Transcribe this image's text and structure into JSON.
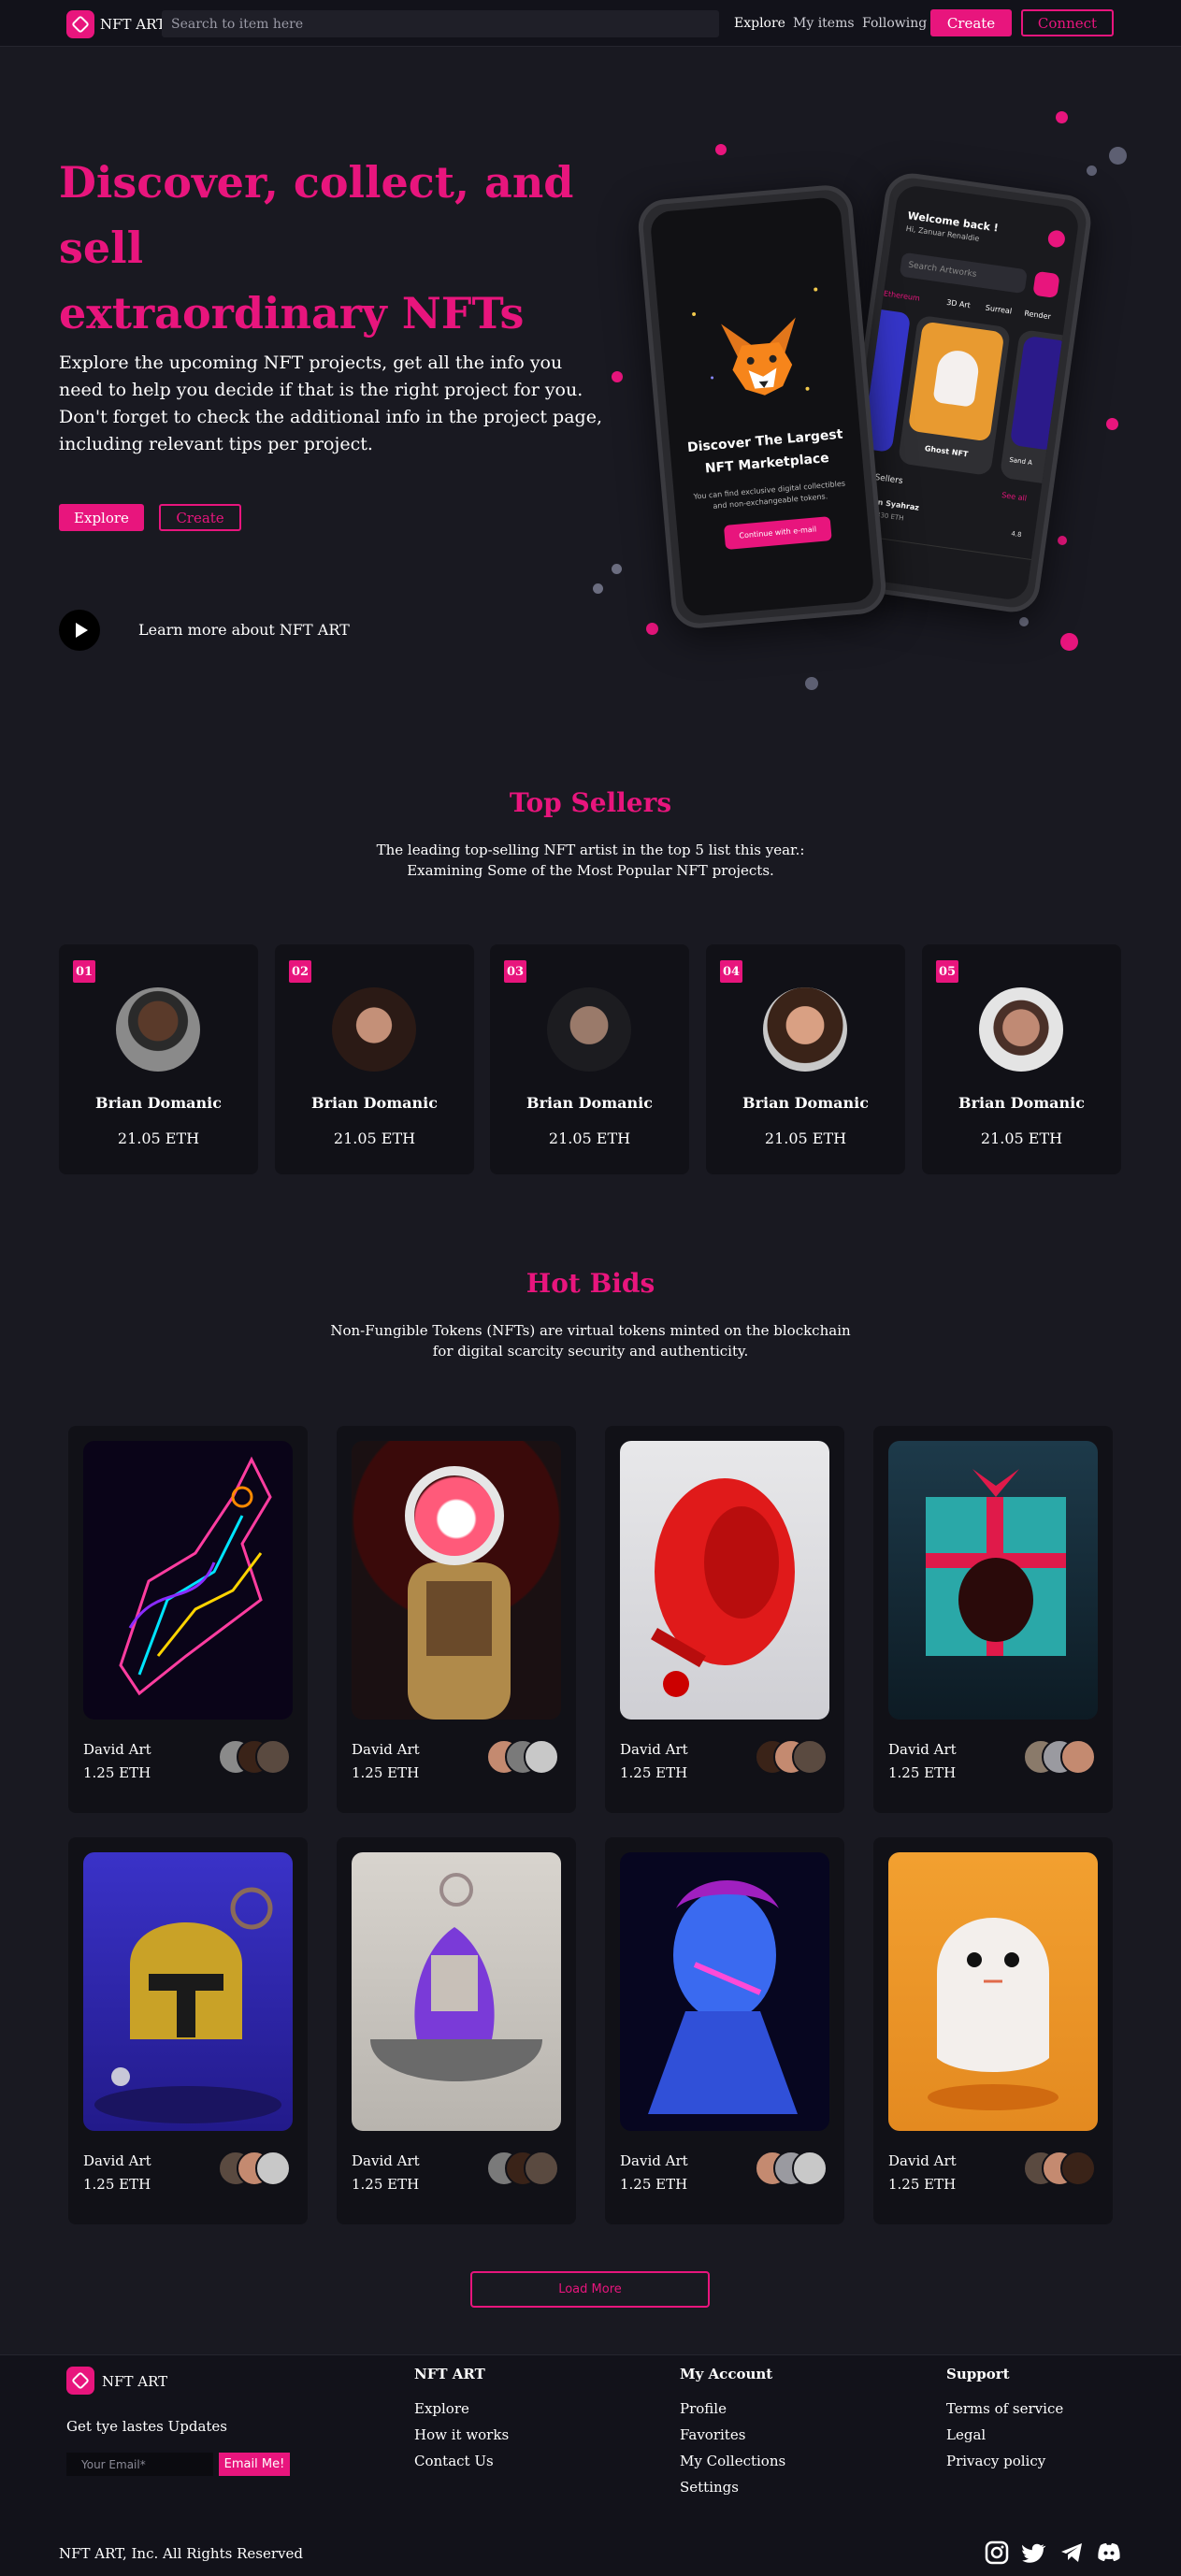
{
  "nav": {
    "logo": "NFT ART",
    "search_placeholder": "Search to item here",
    "links": [
      "Explore",
      "My items",
      "Following"
    ],
    "create_label": "Create",
    "connect_label": "Connect"
  },
  "hero": {
    "title_line1": "Discover, collect, and sell",
    "title_line2": "extraordinary NFTs",
    "description": "Explore the upcoming NFT projects, get all the info you need to help you decide if that is the right project for you. Don't forget to check the additional info in the project page, including relevant tips per project.",
    "explore_label": "Explore",
    "create_label": "Create",
    "learn_more": "Learn more about NFT ART",
    "phone_left": {
      "heading1": "Discover The Largest",
      "heading2": "NFT Marketplace",
      "body1": "You can find exclusive digital collectibles",
      "body2": "and non-exchangeable tokens.",
      "button": "Continue with e-mail"
    },
    "phone_right": {
      "welcome": "Welcome back !",
      "user": "Hi, Zanuar Renaldie",
      "search": "Search Artworks",
      "tabs": [
        "Ethereum",
        "3D Art",
        "Surreal",
        "Render"
      ],
      "card_title": "Ghost NFT",
      "card_side": "Sand A",
      "sellers": "Top Sellers",
      "see_all": "See all",
      "seller_name": "Elin Syahraz",
      "seller_value": "98.830 ETH",
      "seller_score": "4.8"
    }
  },
  "top_sellers": {
    "title": "Top Sellers",
    "sub_line1": "The leading top-selling NFT artist in the top 5 list this year.:",
    "sub_line2": "Examining Some of the Most Popular NFT projects.",
    "sellers": [
      {
        "rank": "01",
        "name": "Brian Domanic",
        "eth": "21.05 ETH"
      },
      {
        "rank": "02",
        "name": "Brian Domanic",
        "eth": "21.05 ETH"
      },
      {
        "rank": "03",
        "name": "Brian Domanic",
        "eth": "21.05 ETH"
      },
      {
        "rank": "04",
        "name": "Brian Domanic",
        "eth": "21.05 ETH"
      },
      {
        "rank": "05",
        "name": "Brian Domanic",
        "eth": "21.05 ETH"
      }
    ]
  },
  "hot_bids": {
    "title": "Hot Bids",
    "sub_line1": "Non-Fungible Tokens (NFTs) are virtual tokens minted on the blockchain",
    "sub_line2": "for digital scarcity security and authenticity.",
    "items": [
      {
        "owner": "David Art",
        "price": "1.25 ETH"
      },
      {
        "owner": "David Art",
        "price": "1.25 ETH"
      },
      {
        "owner": "David Art",
        "price": "1.25 ETH"
      },
      {
        "owner": "David Art",
        "price": "1.25 ETH"
      },
      {
        "owner": "David Art",
        "price": "1.25 ETH"
      },
      {
        "owner": "David Art",
        "price": "1.25 ETH"
      },
      {
        "owner": "David Art",
        "price": "1.25 ETH"
      },
      {
        "owner": "David Art",
        "price": "1.25 ETH"
      }
    ],
    "load_more": "Load More"
  },
  "footer": {
    "logo": "NFT ART",
    "updates": "Get tye lastes Updates",
    "email_placeholder": "Your Email*",
    "email_button": "Email Me!",
    "col1_title": "NFT ART",
    "col1_links": [
      "Explore",
      "How it works",
      "Contact Us"
    ],
    "col2_title": "My Account",
    "col2_links": [
      "Profile",
      "Favorites",
      "My Collections",
      "Settings"
    ],
    "col3_title": "Support",
    "col3_links": [
      "Terms of service",
      "Legal",
      "Privacy policy"
    ],
    "copyright": "NFT ART, Inc. All Rights Reserved",
    "social": [
      "instagram-icon",
      "twitter-icon",
      "telegram-icon",
      "discord-icon"
    ]
  },
  "colors": {
    "accent": "#e8157d",
    "background": "#191921",
    "card": "#111117"
  }
}
